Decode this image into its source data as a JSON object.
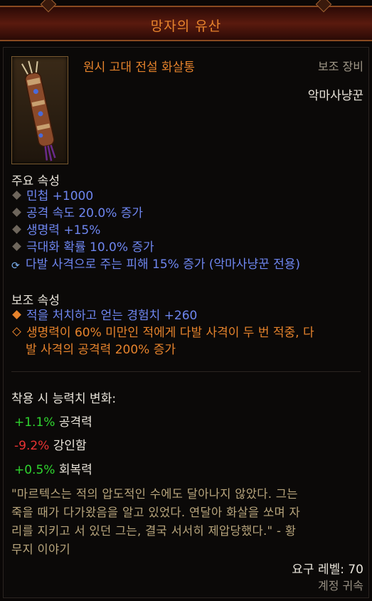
{
  "item": {
    "name": "망자의 유산",
    "type": "원시 고대 전설 화살통",
    "slot": "보조 장비",
    "class": "악마사냥꾼"
  },
  "primary": {
    "title": "주요 속성",
    "props": [
      "민첩 +1000",
      "공격 속도 20.0% 증가",
      "생명력 +15%",
      "극대화 확률 10.0% 증가",
      "다발 사격으로 주는 피해 15% 증가 (악마사냥꾼 전용)"
    ]
  },
  "secondary": {
    "title": "보조 속성",
    "props": [
      "적을 처치하고 얻는 경험치 +260",
      "생명력이 60% 미만인 적에게 다발 사격이 두 번 적중, 다",
      "발 사격의 공격력 200% 증가"
    ]
  },
  "changes": {
    "title": "착용 시 능력치 변화:",
    "rows": [
      {
        "value": "+1.1%",
        "label": "공격력"
      },
      {
        "value": "-9.2%",
        "label": "강인함"
      },
      {
        "value": "+0.5%",
        "label": "회복력"
      }
    ]
  },
  "flavor": [
    "\"마르텍스는 적의 압도적인 수에도 달아나지 않았다. 그는",
    "죽을 때가 다가왔음을 알고 있었다. 연달아 화살을 쏘며 자",
    "리를 지키고 서 있던 그는, 결국 서서히 제압당했다.\" - 황",
    "무지 이야기"
  ],
  "footer": {
    "required_level": "요구 레벨: 70",
    "bound": "계정 귀속"
  },
  "colors": {
    "legendary_orange": "#e6832c",
    "magic_blue": "#6e86f0",
    "positive_green": "#2fd42f",
    "negative_red": "#ea3333"
  }
}
